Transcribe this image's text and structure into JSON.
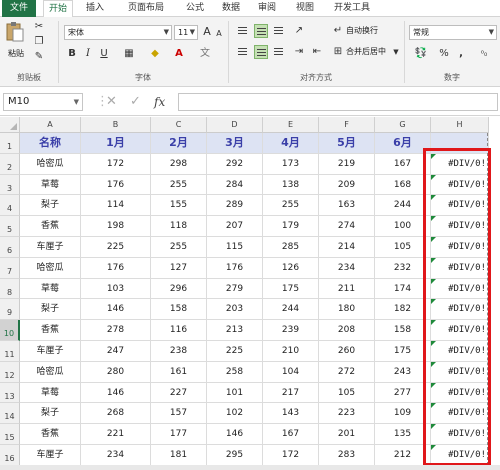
{
  "ribbon_tabs": [
    "文件",
    "开始",
    "插入",
    "页面布局",
    "公式",
    "数据",
    "审阅",
    "视图",
    "开发工具"
  ],
  "ribbon": {
    "paste_label": "粘贴",
    "font_name": "宋体",
    "font_size": "11",
    "bold": "B",
    "italic": "I",
    "underline": "U",
    "grow_font": "A",
    "shrink_font": "A",
    "wrap_text": "自动换行",
    "merge_center": "合并后居中",
    "number_format": "常规",
    "percent": "%",
    "comma": ",",
    "groups": [
      "剪贴板",
      "字体",
      "对齐方式",
      "数字"
    ]
  },
  "formula_bar": {
    "name_box": "M10",
    "cancel": "✕",
    "enter": "✓",
    "fx": "fx",
    "value": ""
  },
  "columns": [
    "A",
    "B",
    "C",
    "D",
    "E",
    "F",
    "G",
    "H"
  ],
  "rows": [
    "1",
    "2",
    "3",
    "4",
    "5",
    "6",
    "7",
    "8",
    "9",
    "10",
    "11",
    "12",
    "13",
    "14",
    "15",
    "16"
  ],
  "selected_row": "10",
  "header_row": [
    "名称",
    "1月",
    "2月",
    "3月",
    "4月",
    "5月",
    "6月",
    ""
  ],
  "data_rows": [
    [
      "哈密瓜",
      "172",
      "298",
      "292",
      "173",
      "219",
      "167",
      "#DIV/0!"
    ],
    [
      "草莓",
      "176",
      "255",
      "284",
      "138",
      "209",
      "168",
      "#DIV/0!"
    ],
    [
      "梨子",
      "114",
      "155",
      "289",
      "255",
      "163",
      "244",
      "#DIV/0!"
    ],
    [
      "香蕉",
      "198",
      "118",
      "207",
      "179",
      "274",
      "100",
      "#DIV/0!"
    ],
    [
      "车厘子",
      "225",
      "255",
      "115",
      "285",
      "214",
      "105",
      "#DIV/0!"
    ],
    [
      "哈密瓜",
      "176",
      "127",
      "176",
      "126",
      "234",
      "232",
      "#DIV/0!"
    ],
    [
      "草莓",
      "103",
      "296",
      "279",
      "175",
      "211",
      "174",
      "#DIV/0!"
    ],
    [
      "梨子",
      "146",
      "158",
      "203",
      "244",
      "180",
      "182",
      "#DIV/0!"
    ],
    [
      "香蕉",
      "278",
      "116",
      "213",
      "239",
      "208",
      "158",
      "#DIV/0!"
    ],
    [
      "车厘子",
      "247",
      "238",
      "225",
      "210",
      "260",
      "175",
      "#DIV/0!"
    ],
    [
      "哈密瓜",
      "280",
      "161",
      "258",
      "104",
      "272",
      "243",
      "#DIV/0!"
    ],
    [
      "草莓",
      "146",
      "227",
      "101",
      "217",
      "105",
      "277",
      "#DIV/0!"
    ],
    [
      "梨子",
      "268",
      "157",
      "102",
      "143",
      "223",
      "109",
      "#DIV/0!"
    ],
    [
      "香蕉",
      "221",
      "177",
      "146",
      "167",
      "201",
      "135",
      "#DIV/0!"
    ],
    [
      "车厘子",
      "234",
      "181",
      "295",
      "172",
      "283",
      "212",
      "#DIV/0!"
    ]
  ],
  "colors": {
    "accent": "#217346",
    "header_fill": "#dde3f3",
    "header_text": "#3a3fa8",
    "highlight": "#e0171a"
  }
}
